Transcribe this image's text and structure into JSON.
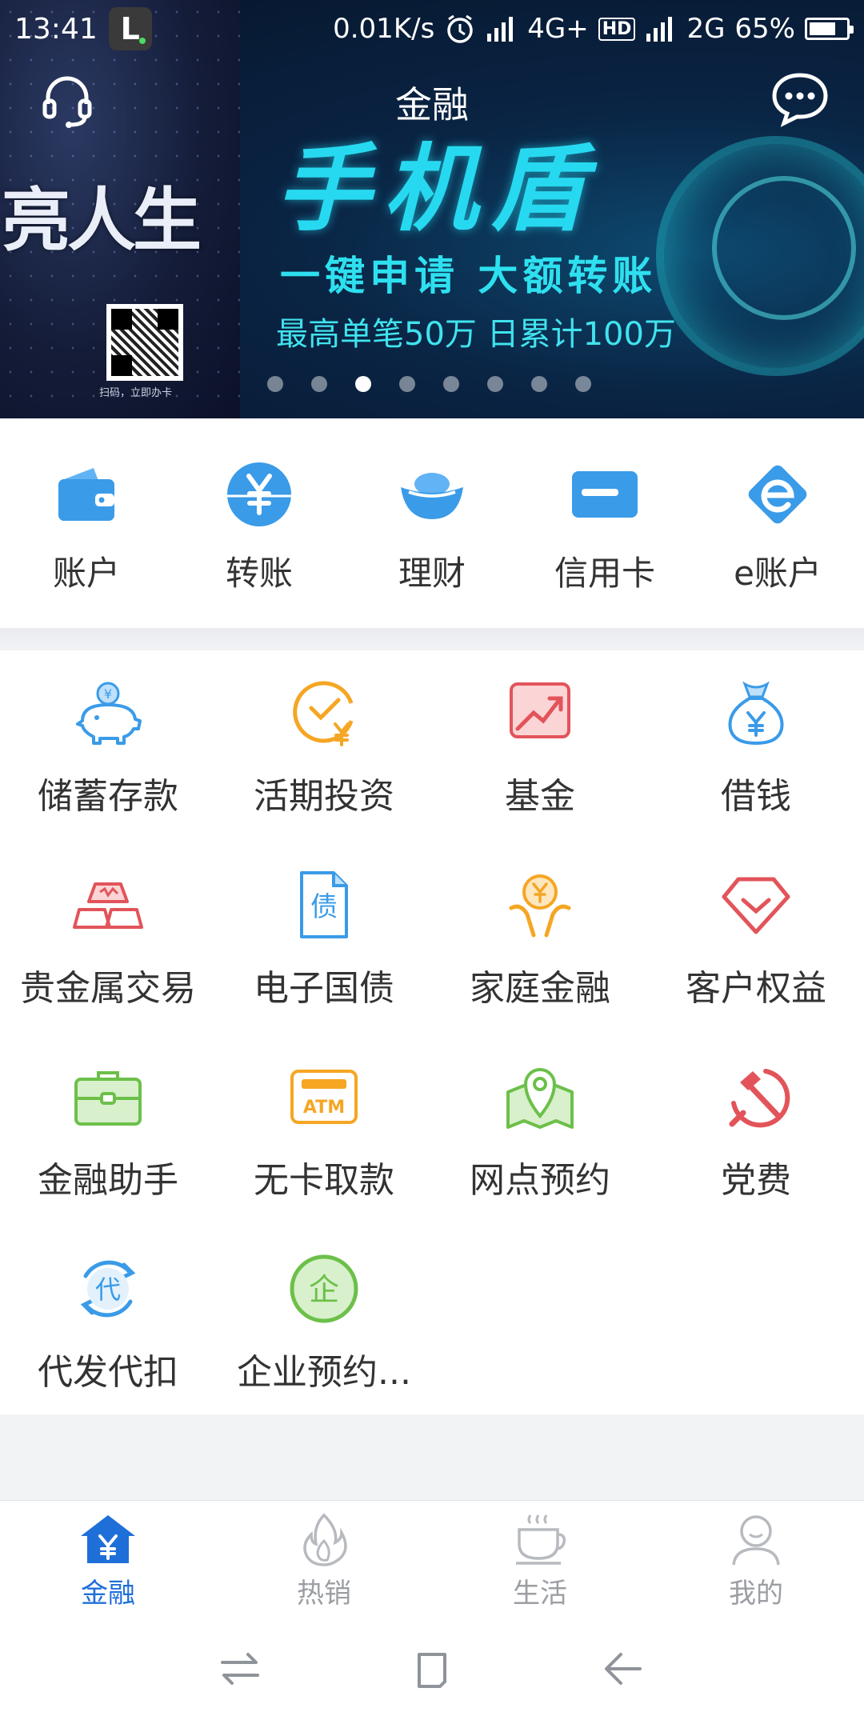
{
  "status_bar": {
    "time": "13:41",
    "app_badge": "L",
    "net_speed": "0.01K/s",
    "network1": "4G+",
    "hd": "HD",
    "network2": "2G",
    "battery": "65%"
  },
  "header": {
    "title": "金融",
    "support_icon": "headset-icon",
    "message_icon": "chat-bubble-icon"
  },
  "banner": {
    "slogan_left": "亮人生",
    "qr_caption": "扫码，立即办卡",
    "title": "手机盾",
    "line2": "一键申请 大额转账",
    "line3": "最高单笔50万 日累计100万",
    "dots_total": 8,
    "active_dot": 3
  },
  "quick_entries": [
    {
      "label": "账户",
      "icon": "wallet-icon"
    },
    {
      "label": "转账",
      "icon": "yuan-transfer-icon"
    },
    {
      "label": "理财",
      "icon": "gold-ingot-icon"
    },
    {
      "label": "信用卡",
      "icon": "credit-card-icon"
    },
    {
      "label": "e账户",
      "icon": "e-account-icon"
    }
  ],
  "services": [
    {
      "label": "储蓄存款",
      "icon": "piggy-bank-icon"
    },
    {
      "label": "活期投资",
      "icon": "clock-yuan-icon"
    },
    {
      "label": "基金",
      "icon": "chart-up-icon"
    },
    {
      "label": "借钱",
      "icon": "money-bag-icon"
    },
    {
      "label": "贵金属交易",
      "icon": "gold-bars-icon"
    },
    {
      "label": "电子国债",
      "icon": "bond-document-icon"
    },
    {
      "label": "家庭金融",
      "icon": "family-yuan-icon"
    },
    {
      "label": "客户权益",
      "icon": "diamond-icon"
    },
    {
      "label": "金融助手",
      "icon": "briefcase-icon"
    },
    {
      "label": "无卡取款",
      "icon": "atm-icon"
    },
    {
      "label": "网点预约",
      "icon": "map-pin-icon"
    },
    {
      "label": "党费",
      "icon": "hammer-sickle-icon"
    },
    {
      "label": "代发代扣",
      "icon": "dai-cycle-icon"
    },
    {
      "label": "企业预约...",
      "icon": "enterprise-icon"
    }
  ],
  "tabs": [
    {
      "label": "金融",
      "icon": "home-yuan-icon",
      "active": true
    },
    {
      "label": "热销",
      "icon": "flame-icon",
      "active": false
    },
    {
      "label": "生活",
      "icon": "coffee-cup-icon",
      "active": false
    },
    {
      "label": "我的",
      "icon": "person-icon",
      "active": false
    }
  ],
  "colors": {
    "primary_blue": "#1f6fd9",
    "icon_blue": "#3a9be8",
    "icon_orange": "#f5a623",
    "icon_red": "#e2545a",
    "icon_green": "#6cc04a",
    "banner_cyan": "#27d9f0"
  }
}
